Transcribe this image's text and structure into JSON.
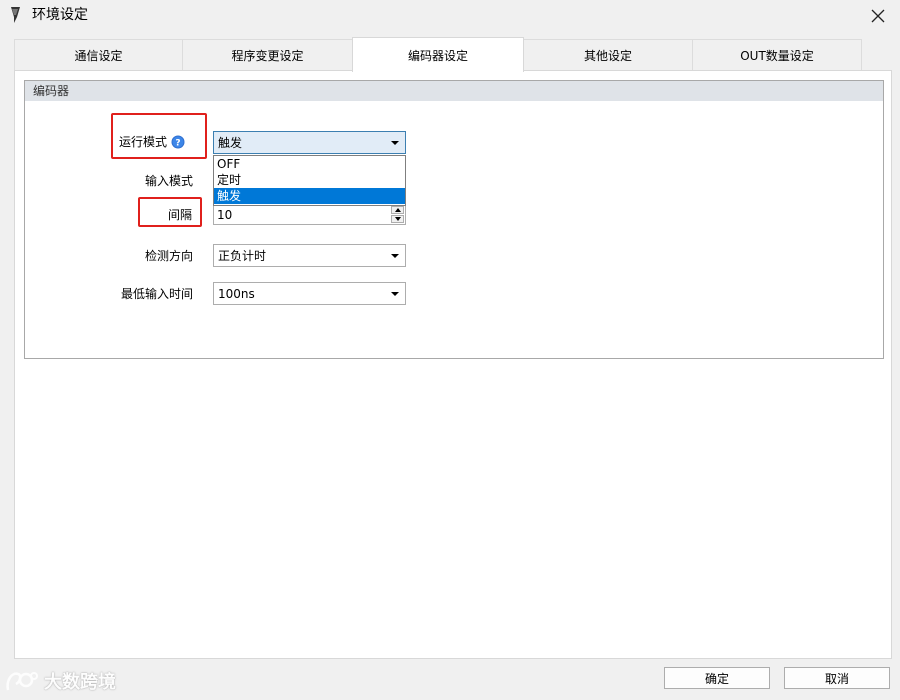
{
  "window": {
    "title": "环境设定"
  },
  "tabs": [
    {
      "label": "通信设定"
    },
    {
      "label": "程序变更设定"
    },
    {
      "label": "编码器设定"
    },
    {
      "label": "其他设定"
    },
    {
      "label": "OUT数量设定"
    }
  ],
  "group": {
    "title": "编码器",
    "fields": {
      "run_mode": {
        "label": "运行模式",
        "value": "触发",
        "options": [
          "OFF",
          "定时",
          "触发"
        ]
      },
      "input_mode": {
        "label": "输入模式"
      },
      "interval": {
        "label": "间隔",
        "value": "10"
      },
      "detect_direction": {
        "label": "检测方向",
        "value": "正负计时"
      },
      "min_input_time": {
        "label": "最低输入时间",
        "value": "100ns"
      }
    }
  },
  "footer": {
    "ok_label": "确定",
    "cancel_label": "取消"
  },
  "watermark": {
    "text": "大数跨境"
  },
  "colors": {
    "highlight": "#e0201c",
    "selection": "#0078d7",
    "group_header": "#dfe3e8"
  }
}
